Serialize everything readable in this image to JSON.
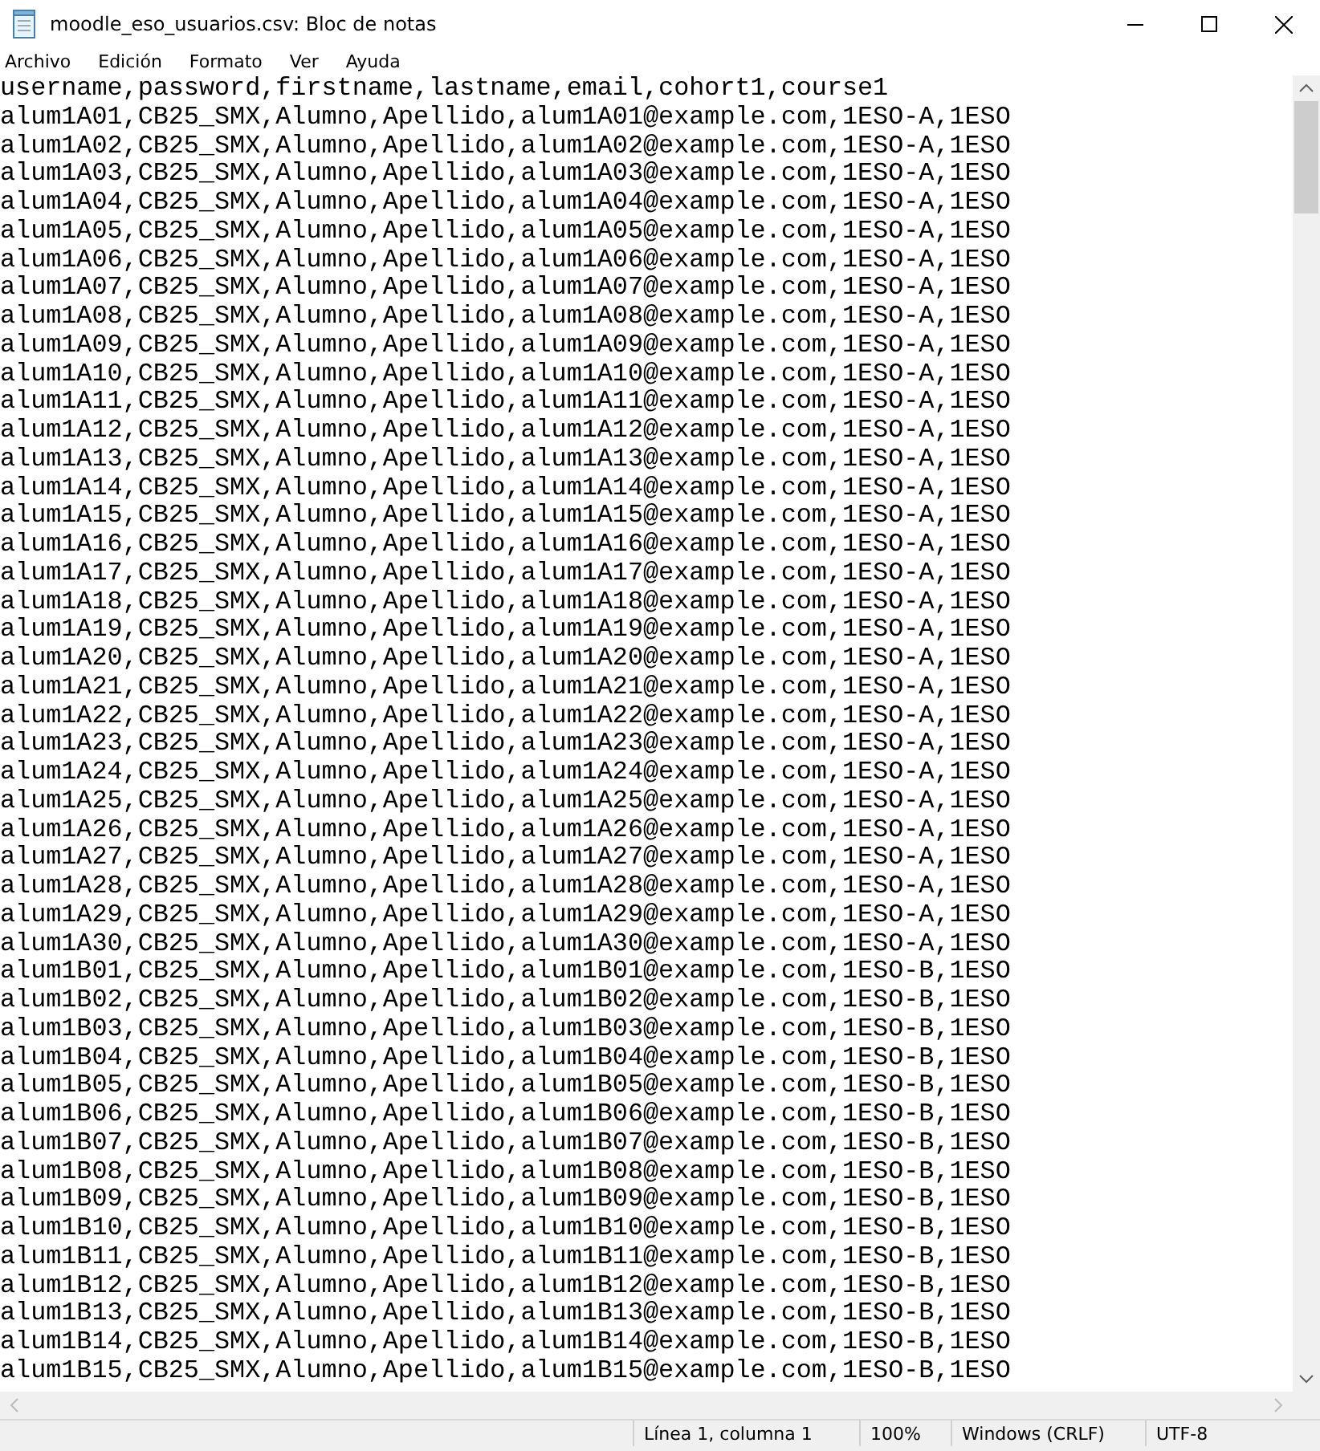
{
  "window": {
    "title": "moodle_eso_usuarios.csv: Bloc de notas"
  },
  "menu": [
    "Archivo",
    "Edición",
    "Formato",
    "Ver",
    "Ayuda"
  ],
  "lines": [
    "username,password,firstname,lastname,email,cohort1,course1",
    "alum1A01,CB25_SMX,Alumno,Apellido,alum1A01@example.com,1ESO-A,1ESO",
    "alum1A02,CB25_SMX,Alumno,Apellido,alum1A02@example.com,1ESO-A,1ESO",
    "alum1A03,CB25_SMX,Alumno,Apellido,alum1A03@example.com,1ESO-A,1ESO",
    "alum1A04,CB25_SMX,Alumno,Apellido,alum1A04@example.com,1ESO-A,1ESO",
    "alum1A05,CB25_SMX,Alumno,Apellido,alum1A05@example.com,1ESO-A,1ESO",
    "alum1A06,CB25_SMX,Alumno,Apellido,alum1A06@example.com,1ESO-A,1ESO",
    "alum1A07,CB25_SMX,Alumno,Apellido,alum1A07@example.com,1ESO-A,1ESO",
    "alum1A08,CB25_SMX,Alumno,Apellido,alum1A08@example.com,1ESO-A,1ESO",
    "alum1A09,CB25_SMX,Alumno,Apellido,alum1A09@example.com,1ESO-A,1ESO",
    "alum1A10,CB25_SMX,Alumno,Apellido,alum1A10@example.com,1ESO-A,1ESO",
    "alum1A11,CB25_SMX,Alumno,Apellido,alum1A11@example.com,1ESO-A,1ESO",
    "alum1A12,CB25_SMX,Alumno,Apellido,alum1A12@example.com,1ESO-A,1ESO",
    "alum1A13,CB25_SMX,Alumno,Apellido,alum1A13@example.com,1ESO-A,1ESO",
    "alum1A14,CB25_SMX,Alumno,Apellido,alum1A14@example.com,1ESO-A,1ESO",
    "alum1A15,CB25_SMX,Alumno,Apellido,alum1A15@example.com,1ESO-A,1ESO",
    "alum1A16,CB25_SMX,Alumno,Apellido,alum1A16@example.com,1ESO-A,1ESO",
    "alum1A17,CB25_SMX,Alumno,Apellido,alum1A17@example.com,1ESO-A,1ESO",
    "alum1A18,CB25_SMX,Alumno,Apellido,alum1A18@example.com,1ESO-A,1ESO",
    "alum1A19,CB25_SMX,Alumno,Apellido,alum1A19@example.com,1ESO-A,1ESO",
    "alum1A20,CB25_SMX,Alumno,Apellido,alum1A20@example.com,1ESO-A,1ESO",
    "alum1A21,CB25_SMX,Alumno,Apellido,alum1A21@example.com,1ESO-A,1ESO",
    "alum1A22,CB25_SMX,Alumno,Apellido,alum1A22@example.com,1ESO-A,1ESO",
    "alum1A23,CB25_SMX,Alumno,Apellido,alum1A23@example.com,1ESO-A,1ESO",
    "alum1A24,CB25_SMX,Alumno,Apellido,alum1A24@example.com,1ESO-A,1ESO",
    "alum1A25,CB25_SMX,Alumno,Apellido,alum1A25@example.com,1ESO-A,1ESO",
    "alum1A26,CB25_SMX,Alumno,Apellido,alum1A26@example.com,1ESO-A,1ESO",
    "alum1A27,CB25_SMX,Alumno,Apellido,alum1A27@example.com,1ESO-A,1ESO",
    "alum1A28,CB25_SMX,Alumno,Apellido,alum1A28@example.com,1ESO-A,1ESO",
    "alum1A29,CB25_SMX,Alumno,Apellido,alum1A29@example.com,1ESO-A,1ESO",
    "alum1A30,CB25_SMX,Alumno,Apellido,alum1A30@example.com,1ESO-A,1ESO",
    "alum1B01,CB25_SMX,Alumno,Apellido,alum1B01@example.com,1ESO-B,1ESO",
    "alum1B02,CB25_SMX,Alumno,Apellido,alum1B02@example.com,1ESO-B,1ESO",
    "alum1B03,CB25_SMX,Alumno,Apellido,alum1B03@example.com,1ESO-B,1ESO",
    "alum1B04,CB25_SMX,Alumno,Apellido,alum1B04@example.com,1ESO-B,1ESO",
    "alum1B05,CB25_SMX,Alumno,Apellido,alum1B05@example.com,1ESO-B,1ESO",
    "alum1B06,CB25_SMX,Alumno,Apellido,alum1B06@example.com,1ESO-B,1ESO",
    "alum1B07,CB25_SMX,Alumno,Apellido,alum1B07@example.com,1ESO-B,1ESO",
    "alum1B08,CB25_SMX,Alumno,Apellido,alum1B08@example.com,1ESO-B,1ESO",
    "alum1B09,CB25_SMX,Alumno,Apellido,alum1B09@example.com,1ESO-B,1ESO",
    "alum1B10,CB25_SMX,Alumno,Apellido,alum1B10@example.com,1ESO-B,1ESO",
    "alum1B11,CB25_SMX,Alumno,Apellido,alum1B11@example.com,1ESO-B,1ESO",
    "alum1B12,CB25_SMX,Alumno,Apellido,alum1B12@example.com,1ESO-B,1ESO",
    "alum1B13,CB25_SMX,Alumno,Apellido,alum1B13@example.com,1ESO-B,1ESO",
    "alum1B14,CB25_SMX,Alumno,Apellido,alum1B14@example.com,1ESO-B,1ESO",
    "alum1B15,CB25_SMX,Alumno,Apellido,alum1B15@example.com,1ESO-B,1ESO"
  ],
  "status_bar": [
    "Línea 1, columna 1",
    "100%",
    "Windows (CRLF)",
    "UTF-8"
  ]
}
